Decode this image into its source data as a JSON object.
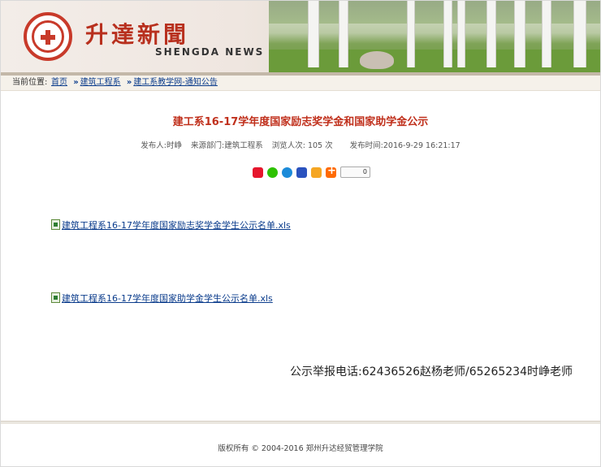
{
  "header": {
    "brand_cn": "升達新聞",
    "brand_en": "SHENGDA NEWS",
    "logo_icon": "school-emblem-icon"
  },
  "breadcrumb": {
    "label": "当前位置:",
    "items": [
      "首页",
      "建筑工程系",
      "建工系教学网-通知公告"
    ],
    "separator": "»"
  },
  "article": {
    "title": "建工系16-17学年度国家励志奖学金和国家助学金公示",
    "meta": {
      "publisher": "发布人:时峥",
      "department": "来源部门:建筑工程系",
      "views": "浏览人次: 105 次",
      "published": "发布时间:2016-9-29 16:21:17"
    },
    "share": {
      "icons": [
        "weibo-icon",
        "wechat-icon",
        "qzone-icon",
        "baidu-icon",
        "star-icon",
        "more-share-icon"
      ],
      "count": "0"
    },
    "attachments": [
      {
        "label": "建筑工程系16-17学年度国家励志奖学金学生公示名单.xls",
        "icon": "excel-file-icon"
      },
      {
        "label": "建筑工程系16-17学年度国家助学金学生公示名单.xls",
        "icon": "excel-file-icon"
      }
    ],
    "report_line": "公示举报电话:62436526赵杨老师/65265234时峥老师"
  },
  "footer": {
    "copyright": "版权所有 © 2004-2016 郑州升达经贸管理学院"
  },
  "colors": {
    "title_red": "#c0301c",
    "brand_red": "#b8301e",
    "link_blue": "#0b3c8c"
  }
}
